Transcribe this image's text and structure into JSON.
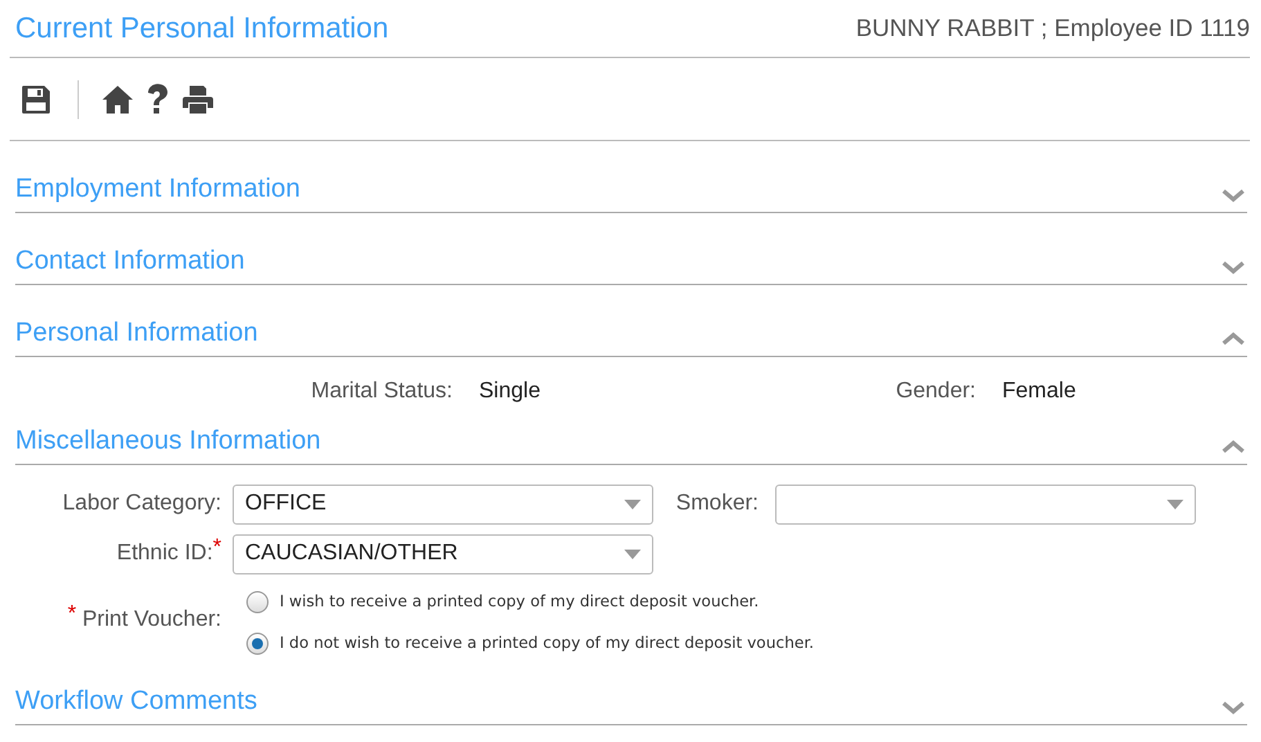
{
  "header": {
    "title": "Current Personal Information",
    "employee": "BUNNY RABBIT ; Employee ID 1119"
  },
  "sections": [
    {
      "title": "Employment Information",
      "expanded": false
    },
    {
      "title": "Contact Information",
      "expanded": false
    },
    {
      "title": "Personal Information",
      "expanded": true,
      "fields": [
        {
          "label": "Marital Status:",
          "value": "Single"
        },
        {
          "label": "Gender:",
          "value": "Female"
        }
      ]
    },
    {
      "title": "Miscellaneous Information",
      "expanded": true,
      "selects": [
        {
          "label": "Labor Category:",
          "value": "OFFICE"
        },
        {
          "label": "Smoker:"
        },
        {
          "label": "Ethnic ID:",
          "value": "CAUCASIAN/OTHER",
          "required_mark": "*"
        }
      ],
      "radio_group": {
        "label": "Print Voucher:",
        "required_mark": "*",
        "options": [
          {
            "label": "I wish to receive a printed copy of my direct deposit voucher.",
            "selected": false
          },
          {
            "label": "I do not wish to receive a printed copy of my direct deposit voucher.",
            "selected": true
          }
        ]
      }
    },
    {
      "title": "Workflow Comments",
      "expanded": false
    }
  ]
}
